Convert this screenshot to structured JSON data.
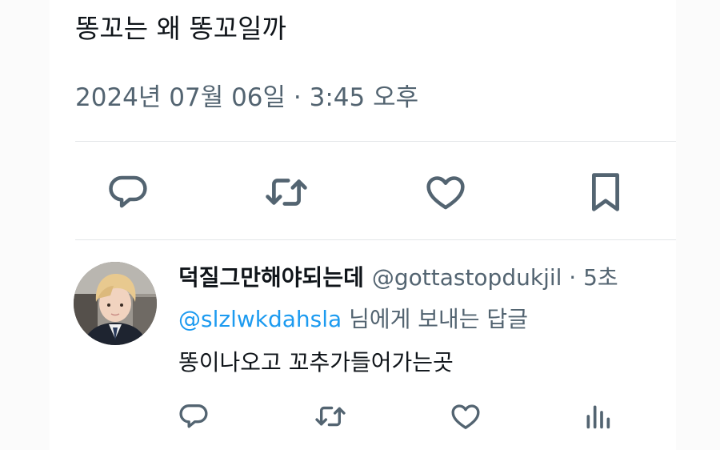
{
  "tweet": {
    "text": "똥꼬는 왜 똥꼬일까",
    "meta": "2024년 07월 06일 · 3:45 오후"
  },
  "actions": {
    "reply_icon": "reply-bubble-icon",
    "retweet_icon": "retweet-icon",
    "like_icon": "heart-icon",
    "bookmark_icon": "bookmark-icon"
  },
  "reply": {
    "display_name": "덕질그만해야되는데",
    "handle": "@gottastopdukjil",
    "time": " · 5초",
    "reply_to_handle": "@slzlwkdahsla",
    "reply_to_suffix": " 님에게 보내는 답글",
    "text": "똥이나오고 꼬추가들어가는곳",
    "action_icons": [
      "reply-bubble-icon",
      "retweet-icon",
      "heart-icon",
      "views-icon"
    ]
  },
  "colors": {
    "text_primary": "#0f1419",
    "text_secondary": "#536471",
    "link": "#1d9bf0",
    "divider": "#e3e6e8"
  }
}
